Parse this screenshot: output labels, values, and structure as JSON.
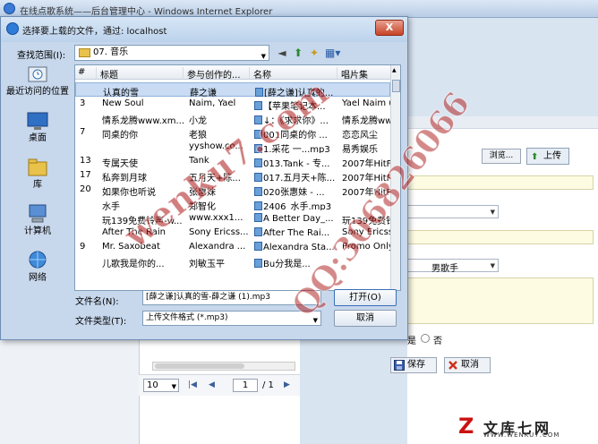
{
  "browser": {
    "title": "在线点歌系统——后台管理中心 - Windows Internet Explorer"
  },
  "background_page": {
    "browse_label": "浏览...",
    "upload_label": "上传",
    "singer_type_value": "男歌手",
    "radio_yes": "是",
    "radio_no": "否",
    "save_label": "保存",
    "cancel_label": "取消",
    "pager": {
      "page_size": "10",
      "current_page": "1",
      "total_pages": "/ 1"
    }
  },
  "dialog": {
    "title": "选择要上载的文件，通过: localhost",
    "close_label": "X",
    "look_in_label": "查找范围(I):",
    "look_in_value": "07. 音乐",
    "places": [
      {
        "label": "最近访问的位置",
        "icon": "recent-places-icon"
      },
      {
        "label": "桌面",
        "icon": "desktop-icon"
      },
      {
        "label": "库",
        "icon": "library-icon"
      },
      {
        "label": "计算机",
        "icon": "computer-icon"
      },
      {
        "label": "网络",
        "icon": "network-icon"
      }
    ],
    "columns": [
      "#",
      "标题",
      "参与创作的...",
      "名称",
      "唱片集"
    ],
    "files": [
      {
        "num": "",
        "title": "认真的雪",
        "artist": "薛之谦",
        "name": "[薛之谦]认真的...",
        "album": ""
      },
      {
        "num": "3",
        "title": "New Soul",
        "artist": "Naim, Yael",
        "name": "【苹果笔记本...",
        "album": "Yael Naim ("
      },
      {
        "num": "",
        "title": "情系龙腾www.xm...",
        "artist": "小龙",
        "name": "↓：《求求你》...",
        "album": "情系龙腾www"
      },
      {
        "num": "7",
        "title": "同桌的你",
        "artist": "老狼",
        "name": "001同桌的你 ...",
        "album": "恋恋风尘"
      },
      {
        "num": "",
        "title": "",
        "artist": "yyshow.co...",
        "name": "1.采花 一...mp3",
        "album": "易秀娱乐"
      },
      {
        "num": "13",
        "title": "专属天使",
        "artist": "Tank",
        "name": "013.Tank - 专...",
        "album": "2007年HitFM"
      },
      {
        "num": "17",
        "title": "私奔到月球",
        "artist": "五月天+陈...",
        "name": "017.五月天+陈...",
        "album": "2007年HitFM"
      },
      {
        "num": "20",
        "title": "如果你也听说",
        "artist": "张惠妹",
        "name": "020张惠妹 - ...",
        "album": "2007年HitFM"
      },
      {
        "num": "",
        "title": "水手",
        "artist": "郑智化",
        "name": "2406_水手.mp3",
        "album": ""
      },
      {
        "num": "",
        "title": "玩139免费铃声-w...",
        "artist": "www.xxx1...",
        "name": "A Better Day_...",
        "album": "玩139免费铃"
      },
      {
        "num": "",
        "title": "After The Rain",
        "artist": "Sony Ericss...",
        "name": "After The Rai...",
        "album": "Sony Ericss"
      },
      {
        "num": "9",
        "title": "Mr. Saxobeat",
        "artist": "Alexandra ...",
        "name": "Alexandra Sta...",
        "album": "Promo Only"
      },
      {
        "num": "",
        "title": "儿歌我是你的...",
        "artist": "刘敏玉平",
        "name": "Bu分我是...",
        "album": ""
      }
    ],
    "file_name_label": "文件名(N):",
    "file_name_value": "[薛之谦]认真的雪-薛之谦 (1).mp3",
    "file_type_label": "文件类型(T):",
    "file_type_value": "上传文件格式 (*.mp3)",
    "open_label": "打开(O)",
    "cancel_label": "取消"
  },
  "watermark": {
    "main_text": "wenku7.com",
    "qq_text": "QQ:306826066",
    "logo_name": "文库七网",
    "logo_url": "WWW.WENKU7.COM"
  }
}
